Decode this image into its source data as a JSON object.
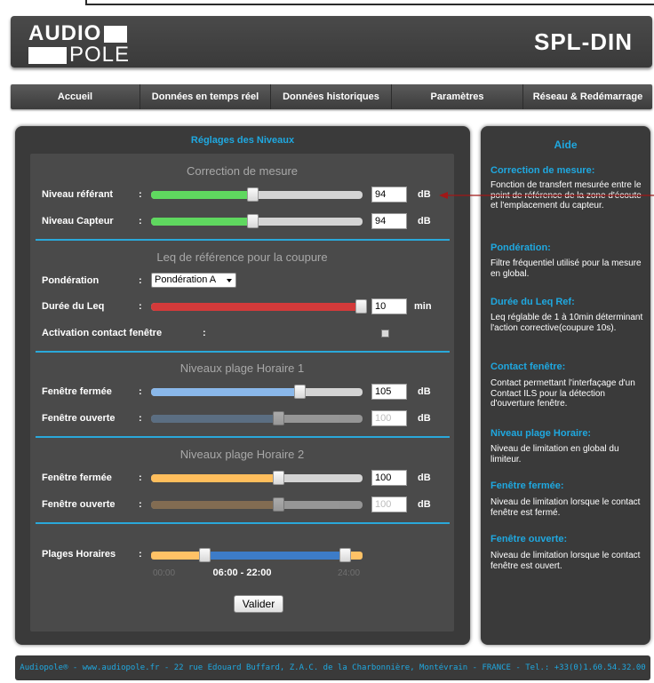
{
  "header": {
    "logo_line1": "AUDIO",
    "logo_line2": "POLE",
    "title": "SPL-DIN"
  },
  "nav": [
    {
      "label": "Accueil"
    },
    {
      "label": "Données en temps réel"
    },
    {
      "label": "Données historiques"
    },
    {
      "label": "Paramètres"
    },
    {
      "label": "Réseau & Redémarrage"
    }
  ],
  "panel": {
    "title": "Réglages des Niveaux",
    "correction": {
      "title": "Correction de mesure",
      "niveau_referant": {
        "label": "Niveau référant",
        "value": "94",
        "unit": "dB",
        "fraction": 0.48
      },
      "niveau_capteur": {
        "label": "Niveau Capteur",
        "value": "94",
        "unit": "dB",
        "fraction": 0.48
      }
    },
    "leq": {
      "title": "Leq de référence pour la coupure",
      "ponderation": {
        "label": "Pondération",
        "value": "Pondération A"
      },
      "duree": {
        "label": "Durée du Leq",
        "value": "10",
        "unit": "min",
        "fraction": 1.0
      },
      "contact": {
        "label": "Activation contact fenêtre",
        "checked": false
      }
    },
    "plage1": {
      "title": "Niveaux plage Horaire 1",
      "fermee": {
        "label": "Fenêtre fermée",
        "value": "105",
        "unit": "dB",
        "fraction": 0.7
      },
      "ouverte": {
        "label": "Fenêtre ouverte",
        "value": "100",
        "unit": "dB",
        "fraction": 0.6
      }
    },
    "plage2": {
      "title": "Niveaux plage Horaire 2",
      "fermee": {
        "label": "Fenêtre fermée",
        "value": "100",
        "unit": "dB",
        "fraction": 0.6
      },
      "ouverte": {
        "label": "Fenêtre ouverte",
        "value": "100",
        "unit": "dB",
        "fraction": 0.6
      }
    },
    "plages": {
      "label": "Plages Horaires",
      "min_label": "00:00",
      "max_label": "24:00",
      "value": "06:00 - 22:00",
      "start_fraction": 0.25,
      "end_fraction": 0.917
    },
    "submit_label": "Valider",
    "colon": ":"
  },
  "aide": {
    "title": "Aide",
    "sections": [
      {
        "heading": "Correction de mesure:",
        "text": "Fonction de transfert mesurée entre le point de référence de la zone d'écoute et l'emplacement du capteur."
      },
      {
        "heading": "Pondération:",
        "text": "Filtre fréquentiel utilisé pour la mesure en global."
      },
      {
        "heading": "Durée du Leq Ref:",
        "text": "Leq réglable de 1 à 10min déterminant l'action corrective(coupure 10s)."
      },
      {
        "heading": "Contact fenêtre:",
        "text": "Contact permettant l'interfaçage d'un Contact ILS pour la détection d'ouverture fenêtre."
      },
      {
        "heading": "Niveau plage Horaire:",
        "text": "Niveau de limitation en global du limiteur."
      },
      {
        "heading": "Fenêtre fermée:",
        "text": "Niveau de limitation lorsque le contact fenêtre est fermé."
      },
      {
        "heading": "Fenêtre ouverte:",
        "text": "Niveau de limitation lorsque le contact fenêtre est ouvert."
      }
    ]
  },
  "footer": "Audiopole® - www.audiopole.fr - 22 rue Edouard Buffard, Z.A.C. de la Charbonnière, Montévrain - FRANCE - Tel.: +33(0)1.60.54.32.00",
  "colors": {
    "accent": "#1fa8e0",
    "green": "#5fd85f",
    "red": "#d43a3a",
    "blue": "#8ab8ea",
    "blue_dim": "#6a8cb0",
    "orange": "#ffbe5c",
    "brown": "#b0895a"
  }
}
